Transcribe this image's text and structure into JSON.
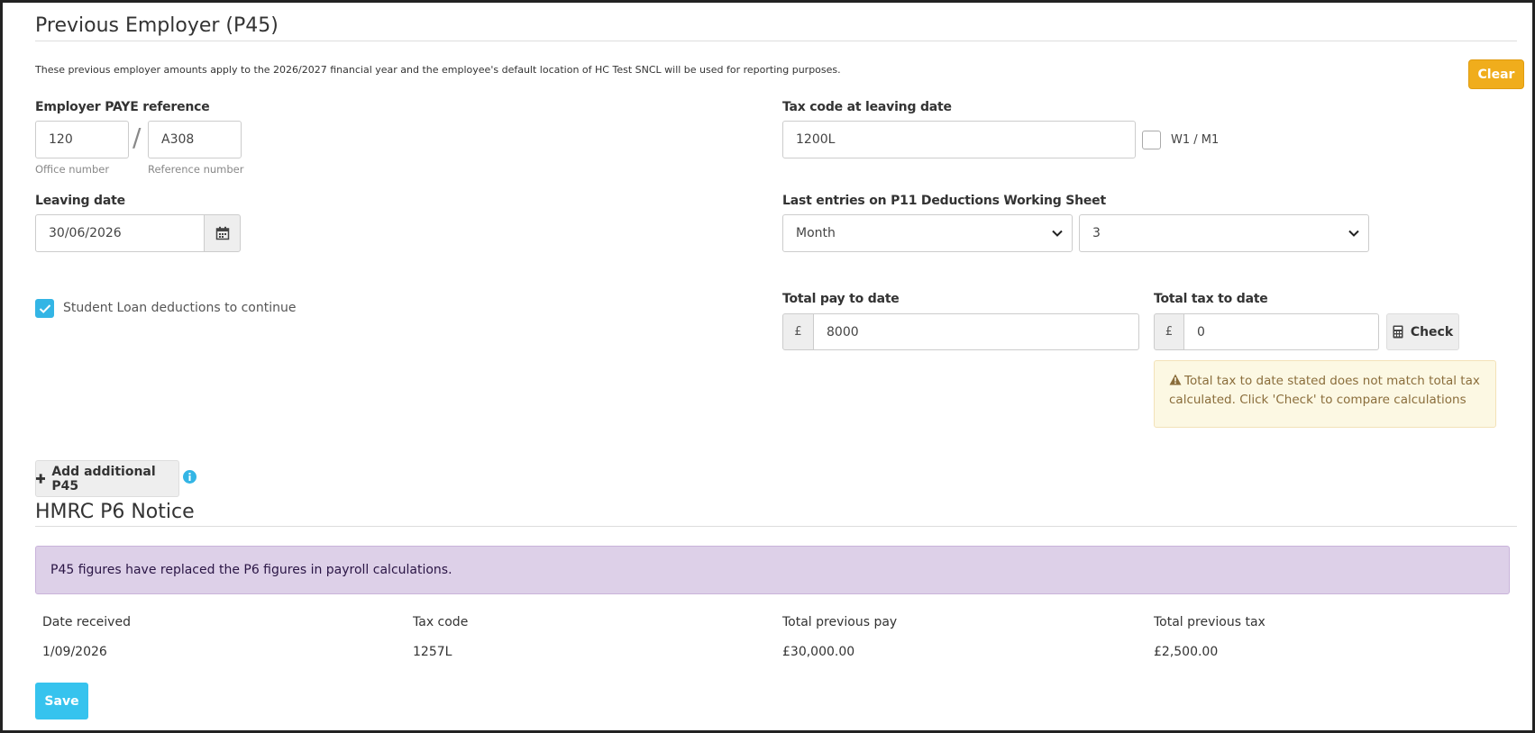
{
  "p45": {
    "title": "Previous Employer (P45)",
    "info": "These previous employer amounts apply to the 2026/2027 financial year and the employee's default location of HC Test SNCL will be used for reporting purposes.",
    "clear_label": "Clear",
    "paye": {
      "label": "Employer PAYE reference",
      "office_value": "120",
      "reference_value": "A308",
      "separator": "/",
      "office_help": "Office number",
      "reference_help": "Reference number"
    },
    "tax_code": {
      "label": "Tax code at leaving date",
      "value": "1200L",
      "w1m1_label": "W1 / M1",
      "w1m1_checked": false
    },
    "leaving_date": {
      "label": "Leaving date",
      "value": "30/06/2026"
    },
    "last_entries": {
      "label": "Last entries on P11 Deductions Working Sheet",
      "period_type": "Month",
      "period_number": "3"
    },
    "student_loan": {
      "label": "Student Loan deductions to continue",
      "checked": true
    },
    "total_pay": {
      "label": "Total pay to date",
      "currency": "£",
      "value": "8000"
    },
    "total_tax": {
      "label": "Total tax to date",
      "currency": "£",
      "value": "0",
      "check_label": "Check"
    },
    "warning": "Total tax to date stated does not match total tax calculated. Click 'Check' to compare calculations",
    "add_label": "Add additional P45"
  },
  "p6": {
    "title": "HMRC P6 Notice",
    "notice": "P45 figures have replaced the P6 figures in payroll calculations.",
    "columns": [
      "Date received",
      "Tax code",
      "Total previous pay",
      "Total previous tax"
    ],
    "row": [
      "1/09/2026",
      "1257L",
      "£30,000.00",
      "£2,500.00"
    ]
  },
  "save_label": "Save",
  "colors": {
    "clear": "#f0ad1c",
    "save": "#36c3ee",
    "checkbox": "#33b5e5",
    "warning_bg": "#fcf8e3",
    "notice_bg": "#ddd0e8",
    "info_icon": "#33b5e5"
  },
  "icons": [
    "calendar-icon",
    "check-icon",
    "warning-icon",
    "calculator-icon",
    "plus-icon",
    "info-icon",
    "chevron-down-icon"
  ]
}
